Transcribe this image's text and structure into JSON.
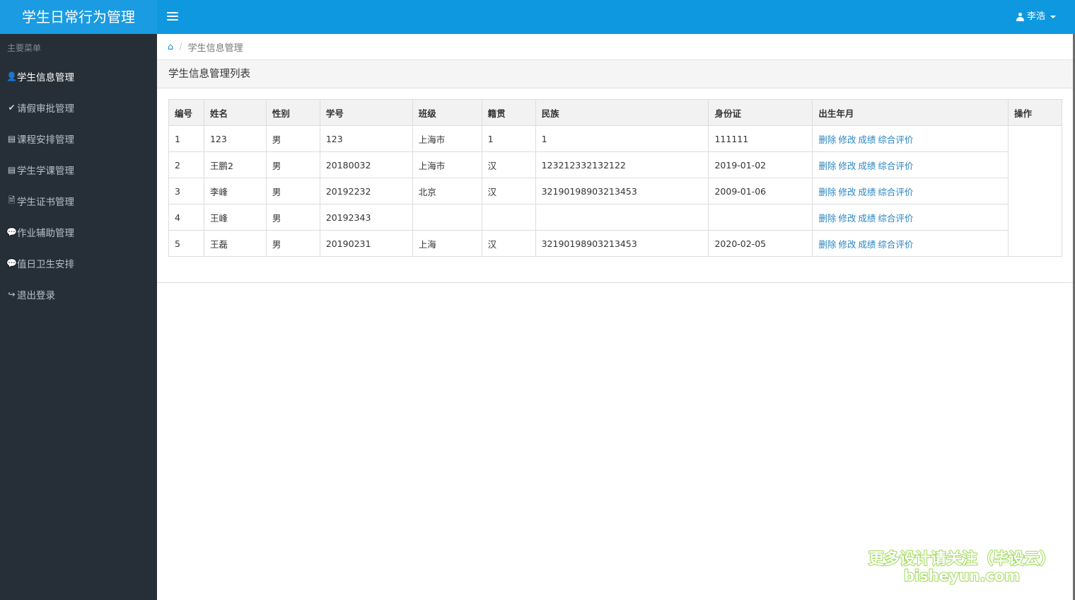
{
  "app": {
    "title": "学生日常行为管理",
    "user_name": "李浩"
  },
  "sidebar": {
    "heading": "主要菜单",
    "items": [
      {
        "label": "学生信息管理",
        "icon": "user-icon",
        "glyph": "👤",
        "active": true
      },
      {
        "label": "请假审批管理",
        "icon": "check-icon",
        "glyph": "✔",
        "active": false
      },
      {
        "label": "课程安排管理",
        "icon": "book-icon",
        "glyph": "▤",
        "active": false
      },
      {
        "label": "学生学课管理",
        "icon": "book-icon",
        "glyph": "▤",
        "active": false
      },
      {
        "label": "学生证书管理",
        "icon": "file-word-icon",
        "glyph": "🗎",
        "active": false
      },
      {
        "label": "作业辅助管理",
        "icon": "comments-icon",
        "glyph": "💬",
        "active": false
      },
      {
        "label": "值日卫生安排",
        "icon": "comments-icon",
        "glyph": "💬",
        "active": false
      },
      {
        "label": "退出登录",
        "icon": "share-icon",
        "glyph": "↪",
        "active": false
      }
    ]
  },
  "breadcrumb": {
    "home_icon": "⌂",
    "separator": "/",
    "current": "学生信息管理"
  },
  "panel": {
    "title": "学生信息管理列表"
  },
  "table": {
    "headers": [
      "编号",
      "姓名",
      "性别",
      "学号",
      "班级",
      "籍贯",
      "民族",
      "身份证",
      "出生年月",
      "操作"
    ],
    "actions": [
      "删除",
      "修改",
      "成绩",
      "综合评价"
    ],
    "rows": [
      {
        "id": "1",
        "name": "123",
        "gender": "男",
        "student_no": "123",
        "class": "上海市",
        "native_place": "1",
        "ethnicity": "1",
        "id_card": "111111"
      },
      {
        "id": "2",
        "name": "王鹏2",
        "gender": "男",
        "student_no": "20180032",
        "class": "上海市",
        "native_place": "汉",
        "ethnicity": "123212332132122",
        "id_card": "2019-01-02"
      },
      {
        "id": "3",
        "name": "李峰",
        "gender": "男",
        "student_no": "20192232",
        "class": "北京",
        "native_place": "汉",
        "ethnicity": "32190198903213453",
        "id_card": "2009-01-06"
      },
      {
        "id": "4",
        "name": "王峰",
        "gender": "男",
        "student_no": "20192343",
        "class": "",
        "native_place": "",
        "ethnicity": "",
        "id_card": ""
      },
      {
        "id": "5",
        "name": "王磊",
        "gender": "男",
        "student_no": "20190231",
        "class": "上海",
        "native_place": "汉",
        "ethnicity": "32190198903213453",
        "id_card": "2020-02-05"
      }
    ]
  },
  "watermark": {
    "line1": "更多设计请关注（毕设云）",
    "line2": "bisheyun.com"
  },
  "colors": {
    "navbar": "#0e98e0",
    "sidebar": "#262f37",
    "link": "#2a86c5"
  }
}
